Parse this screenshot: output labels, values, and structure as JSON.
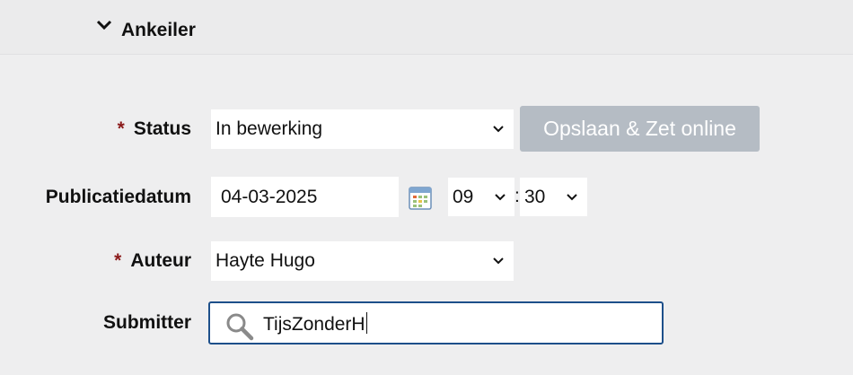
{
  "section": {
    "title": "Ankeiler",
    "expanded": true
  },
  "form": {
    "required_marker": "*",
    "status": {
      "label": "Status",
      "value": "In bewerking"
    },
    "save_button": "Opslaan & Zet online",
    "publication_date": {
      "label": "Publicatiedatum",
      "date": "04-03-2025",
      "hour": "09",
      "separator": ":",
      "minute": "30"
    },
    "author": {
      "label": "Auteur",
      "value": "Hayte Hugo"
    },
    "submitter": {
      "label": "Submitter",
      "value": "TijsZonderH"
    }
  },
  "colors": {
    "accent_border": "#1d4f8a",
    "required": "#8b1a1a",
    "button_disabled": "#b5bcc4"
  }
}
